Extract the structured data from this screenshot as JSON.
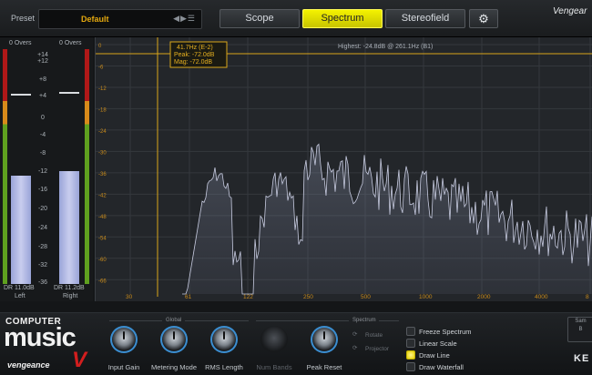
{
  "header": {
    "preset_label": "Preset",
    "preset_name": "Default",
    "preset_controls": "◀▶☰",
    "tabs": [
      {
        "label": "Scope",
        "active": false
      },
      {
        "label": "Spectrum",
        "active": true
      },
      {
        "label": "Stereofield",
        "active": false
      }
    ],
    "settings_icon": "gear-icon",
    "brand": "Vengear"
  },
  "meters": {
    "left_overs": "0 Overs",
    "right_overs": "0 Overs",
    "left_dr": "DR 11.0dB",
    "right_dr": "DR 11.2dB",
    "left_name": "Left",
    "right_name": "Right",
    "scale": [
      "+14",
      "+12",
      "+8",
      "+4",
      "0",
      "-4",
      "-8",
      "-12",
      "-16",
      "-20",
      "-24",
      "-28",
      "-32",
      "-36"
    ],
    "left_level_db": -13,
    "right_level_db": -12,
    "colors": {
      "clip": "#b01818",
      "warn": "#d88a1a",
      "ok": "#5fa01f",
      "bar": "#b4bce4"
    }
  },
  "spectrum": {
    "cursor_readout": [
      "41.7Hz (E-2)",
      "Peak: -72.0dB",
      "Mag: -72.0dB"
    ],
    "highest": "Highest: -24.8dB @ 261.1Hz (B1)",
    "db_labels": [
      "0",
      "-6",
      "-12",
      "-18",
      "-24",
      "-30",
      "-36",
      "-42",
      "-48",
      "-54",
      "-60",
      "-66"
    ],
    "freq_labels": [
      "30",
      "61",
      "122",
      "250",
      "500",
      "1000",
      "2000",
      "4000",
      "8"
    ],
    "accent": "#f0c020"
  },
  "bottom": {
    "logo_line1": "COMPUTER",
    "logo_line2": "music",
    "logo_line3": "vengeance",
    "logo_v": "V",
    "global_label": "Global",
    "spectrum_label": "Spectrum",
    "knobs": [
      {
        "label": "Input Gain",
        "enabled": true
      },
      {
        "label": "Metering Mode",
        "enabled": true
      },
      {
        "label": "RMS Length",
        "enabled": true
      },
      {
        "label": "Num Bands",
        "enabled": false
      },
      {
        "label": "Peak Reset",
        "enabled": true
      }
    ],
    "spectrum_opts": [
      "Rotate",
      "Projector"
    ],
    "checkboxes": [
      {
        "label": "Freeze Spectrum",
        "checked": false
      },
      {
        "label": "Linear Scale",
        "checked": false
      },
      {
        "label": "Draw Line",
        "checked": true
      },
      {
        "label": "Draw Waterfall",
        "checked": false
      }
    ],
    "sample_lines": [
      "Sam",
      "B"
    ],
    "ke_logo": "KE"
  }
}
